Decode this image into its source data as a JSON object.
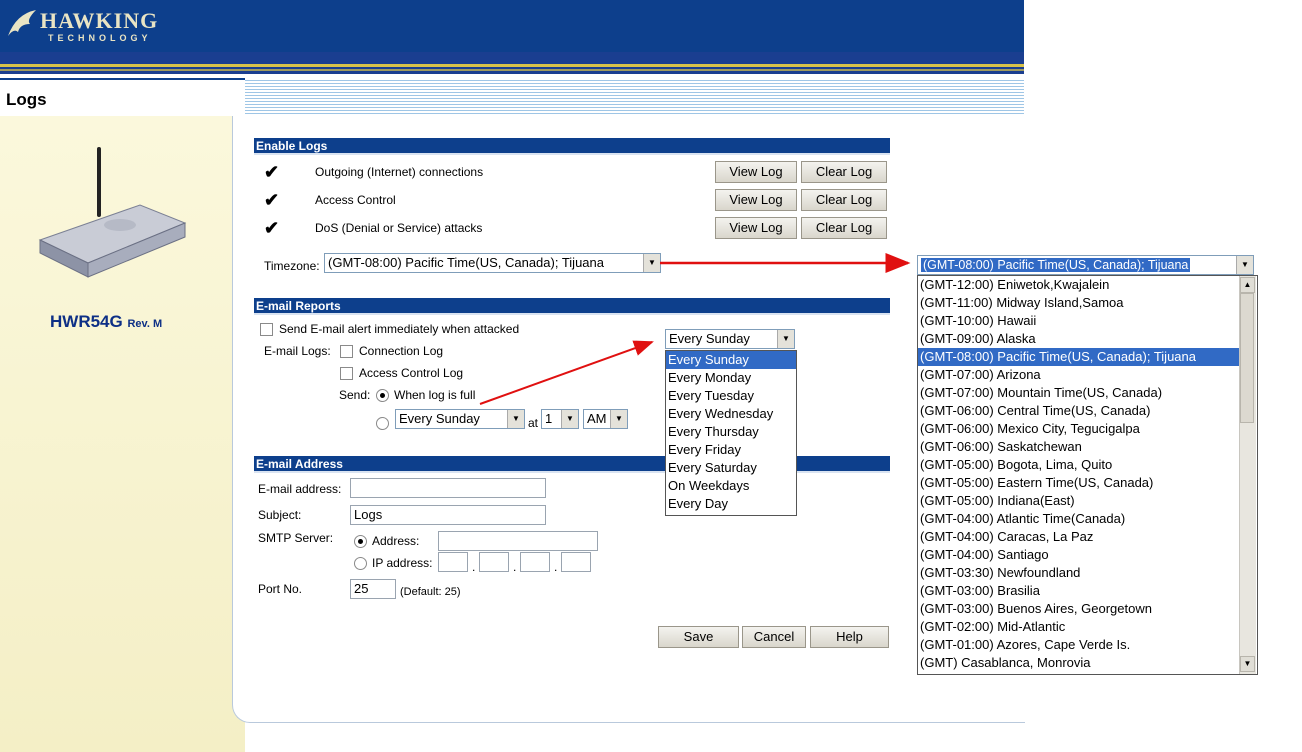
{
  "brand": {
    "name": "HAWKING",
    "subname": "TECHNOLOGY",
    "model": "HWR54G",
    "revision": "Rev. M"
  },
  "page_title": "Logs",
  "enable_logs": {
    "title": "Enable Logs",
    "rows": [
      {
        "label": "Outgoing (Internet) connections",
        "view": "View Log",
        "clear": "Clear Log"
      },
      {
        "label": "Access Control",
        "view": "View Log",
        "clear": "Clear Log"
      },
      {
        "label": "DoS (Denial or Service) attacks",
        "view": "View Log",
        "clear": "Clear Log"
      }
    ],
    "timezone_label": "Timezone:",
    "timezone_value": "(GMT-08:00) Pacific Time(US, Canada); Tijuana"
  },
  "email_reports": {
    "title": "E-mail Reports",
    "alert_label": "Send E-mail alert immediately when attacked",
    "logs_label": "E-mail Logs:",
    "connection_log": "Connection Log",
    "access_control_log": "Access Control Log",
    "send_label": "Send:",
    "when_full": "When log is full",
    "day_value": "Every Sunday",
    "at_label": "at",
    "hour_value": "1",
    "ampm_value": "AM"
  },
  "day_dropdown": {
    "value": "Every Sunday",
    "options": [
      "Every Sunday",
      "Every Monday",
      "Every Tuesday",
      "Every Wednesday",
      "Every Thursday",
      "Every Friday",
      "Every Saturday",
      "On Weekdays",
      "Every Day"
    ]
  },
  "email_address": {
    "title": "E-mail Address",
    "email_label": "E-mail address:",
    "email_value": "",
    "subject_label": "Subject:",
    "subject_value": "Logs",
    "smtp_label": "SMTP Server:",
    "address_label": "Address:",
    "ip_label": "IP address:",
    "port_label": "Port No.",
    "port_value": "25",
    "port_default": "(Default: 25)"
  },
  "actions": {
    "save": "Save",
    "cancel": "Cancel",
    "help": "Help"
  },
  "timezone_dropdown": {
    "value": "(GMT-08:00) Pacific Time(US, Canada); Tijuana",
    "options": [
      "(GMT-12:00) Eniwetok,Kwajalein",
      "(GMT-11:00) Midway Island,Samoa",
      "(GMT-10:00) Hawaii",
      "(GMT-09:00) Alaska",
      "(GMT-08:00) Pacific Time(US, Canada); Tijuana",
      "(GMT-07:00) Arizona",
      "(GMT-07:00) Mountain Time(US, Canada)",
      "(GMT-06:00) Central Time(US, Canada)",
      "(GMT-06:00) Mexico City, Tegucigalpa",
      "(GMT-06:00) Saskatchewan",
      "(GMT-05:00) Bogota, Lima, Quito",
      "(GMT-05:00) Eastern Time(US, Canada)",
      "(GMT-05:00) Indiana(East)",
      "(GMT-04:00) Atlantic Time(Canada)",
      "(GMT-04:00) Caracas, La Paz",
      "(GMT-04:00) Santiago",
      "(GMT-03:30) Newfoundland",
      "(GMT-03:00) Brasilia",
      "(GMT-03:00) Buenos Aires, Georgetown",
      "(GMT-02:00) Mid-Atlantic",
      "(GMT-01:00) Azores, Cape Verde Is.",
      "(GMT) Casablanca, Monrovia"
    ]
  },
  "colors": {
    "header_blue": "#0d3f8c",
    "highlight": "#316ac5",
    "arrow_red": "#e01010"
  }
}
